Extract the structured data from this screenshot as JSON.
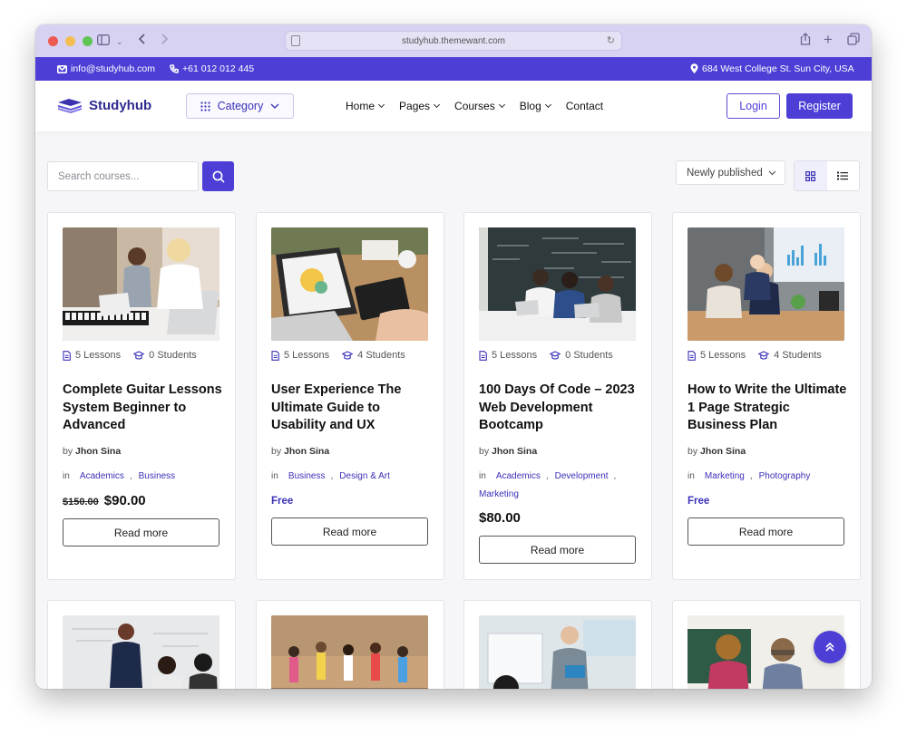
{
  "browser": {
    "url": "studyhub.themewant.com"
  },
  "topbar": {
    "email": "info@studyhub.com",
    "phone": "+61 012 012 445",
    "address": "684 West College St. Sun City, USA"
  },
  "header": {
    "logo_text": "Studyhub",
    "category_label": "Category",
    "nav": [
      "Home",
      "Pages",
      "Courses",
      "Blog",
      "Contact"
    ],
    "login_label": "Login",
    "register_label": "Register"
  },
  "toolbar": {
    "search_placeholder": "Search courses...",
    "sort_label": "Newly published"
  },
  "labels": {
    "by": "by",
    "in": "in",
    "read_more": "Read more"
  },
  "courses": [
    {
      "lessons": "5 Lessons",
      "students": "0 Students",
      "title": "Complete Guitar Lessons System Beginner to Advanced",
      "author": "Jhon Sina",
      "categories": [
        "Academics",
        "Business"
      ],
      "old_price": "$150.00",
      "price": "$90.00"
    },
    {
      "lessons": "5 Lessons",
      "students": "4 Students",
      "title": "User Experience The Ultimate Guide to Usability and UX",
      "author": "Jhon Sina",
      "categories": [
        "Business",
        "Design & Art"
      ],
      "price": "Free"
    },
    {
      "lessons": "5 Lessons",
      "students": "0 Students",
      "title": "100 Days Of Code – 2023 Web Development Bootcamp",
      "author": "Jhon Sina",
      "categories": [
        "Academics",
        "Development",
        "Marketing"
      ],
      "price": "$80.00"
    },
    {
      "lessons": "5 Lessons",
      "students": "4 Students",
      "title": "How to Write the Ultimate 1 Page Strategic Business Plan",
      "author": "Jhon Sina",
      "categories": [
        "Marketing",
        "Photography"
      ],
      "price": "Free"
    }
  ],
  "colors": {
    "brand": "#4d3fd6",
    "link": "#3a31b8"
  }
}
